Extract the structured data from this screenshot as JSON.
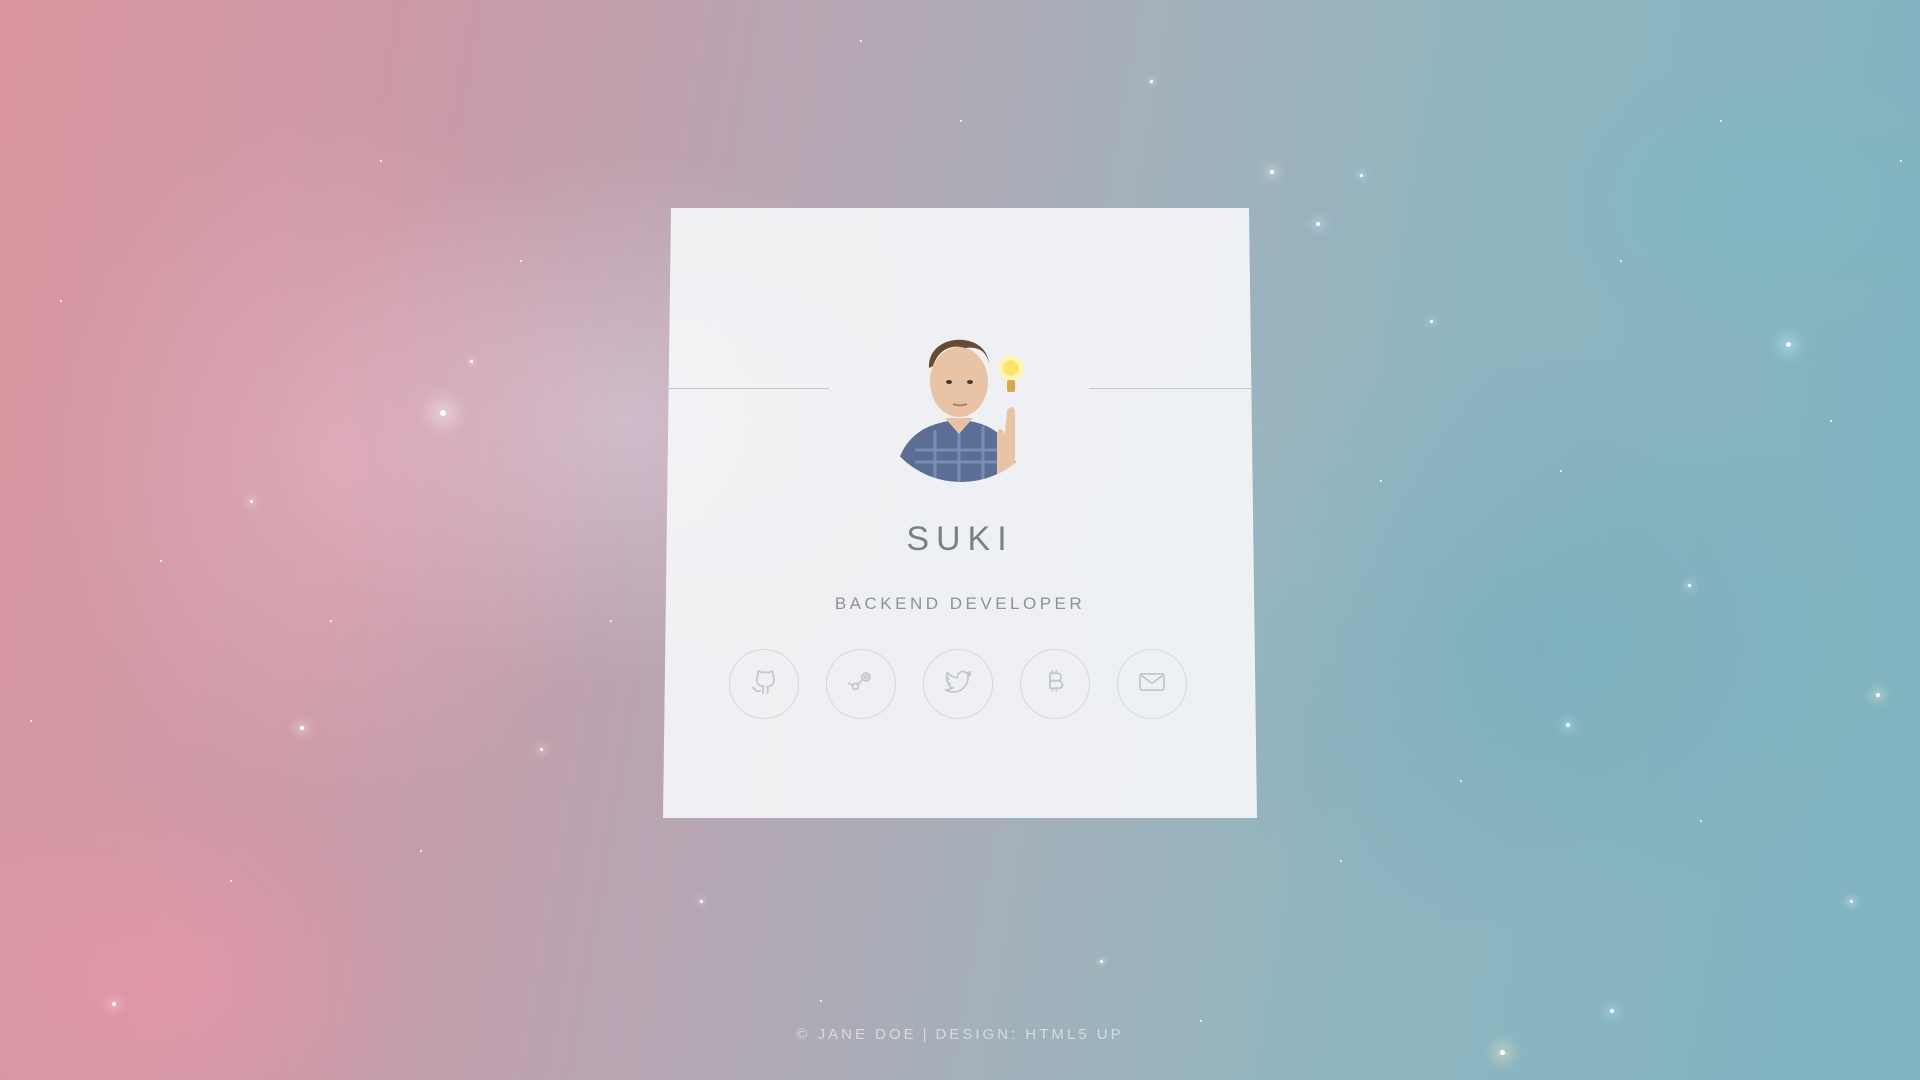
{
  "profile": {
    "name": "SUKI",
    "role": "BACKEND DEVELOPER"
  },
  "social": [
    {
      "icon": "github-icon",
      "label": "GitHub"
    },
    {
      "icon": "steam-icon",
      "label": "Steam"
    },
    {
      "icon": "twitter-icon",
      "label": "Twitter"
    },
    {
      "icon": "bitcoin-icon",
      "label": "Bitcoin"
    },
    {
      "icon": "envelope-icon",
      "label": "Email"
    }
  ],
  "footer": {
    "copyright": "© JANE DOE",
    "separator": "|",
    "design": "DESIGN: HTML5 UP"
  },
  "colors": {
    "icon_stroke": "#c4c7cc",
    "card_bg": "#f6f7f9",
    "text": "#7b8088"
  }
}
